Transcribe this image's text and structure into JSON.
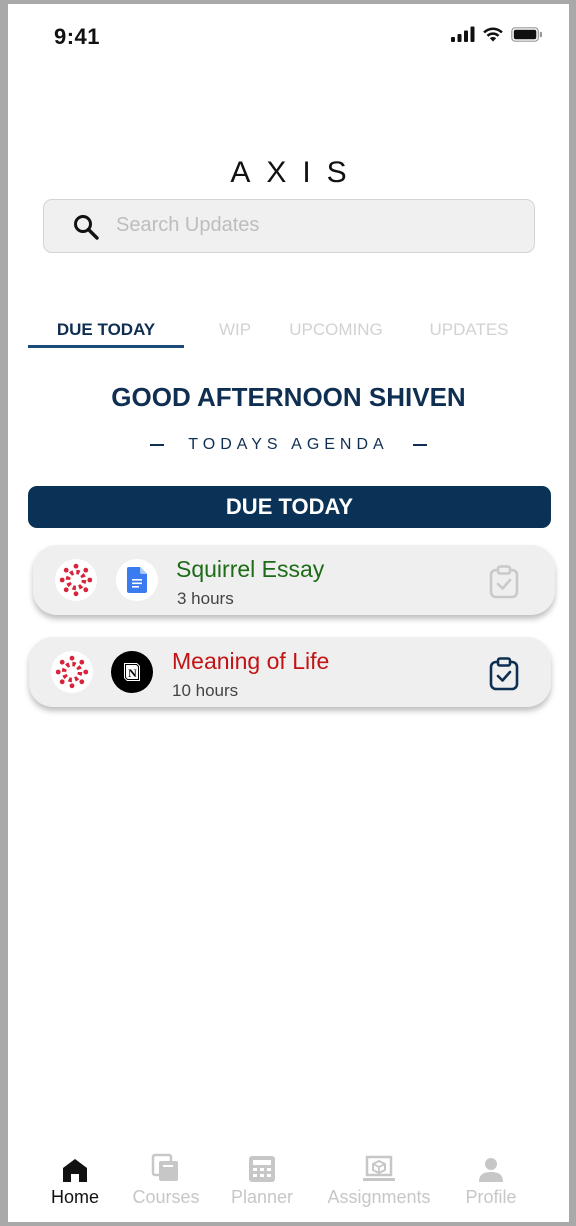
{
  "status_bar": {
    "time": "9:41"
  },
  "app": {
    "title": "AXIS"
  },
  "search": {
    "placeholder": "Search Updates"
  },
  "tabs": [
    {
      "label": "DUE TODAY",
      "active": true
    },
    {
      "label": "WIP",
      "active": false
    },
    {
      "label": "UPCOMING",
      "active": false
    },
    {
      "label": "UPDATES",
      "active": false
    }
  ],
  "greeting": "GOOD AFTERNOON SHIVEN",
  "agenda_label": "TODAYS AGENDA",
  "section_title": "DUE TODAY",
  "tasks": [
    {
      "title": "Squirrel Essay",
      "time": "3 hours",
      "title_color": "#1e6b17",
      "source_icon": "canvas-icon",
      "app_icon": "google-docs-icon",
      "done": false
    },
    {
      "title": "Meaning of Life",
      "time": "10 hours",
      "title_color": "#c21414",
      "source_icon": "canvas-icon",
      "app_icon": "notion-icon",
      "done": true
    }
  ],
  "bottom_nav": [
    {
      "label": "Home",
      "icon": "home-icon",
      "active": true
    },
    {
      "label": "Courses",
      "icon": "courses-icon",
      "active": false
    },
    {
      "label": "Planner",
      "icon": "calculator-icon",
      "active": false
    },
    {
      "label": "Assignments",
      "icon": "assignments-icon",
      "active": false
    },
    {
      "label": "Profile",
      "icon": "person-icon",
      "active": false
    }
  ],
  "colors": {
    "primary": "#0a3156",
    "inactive": "#c7c7c7",
    "card_bg": "#efefef"
  }
}
